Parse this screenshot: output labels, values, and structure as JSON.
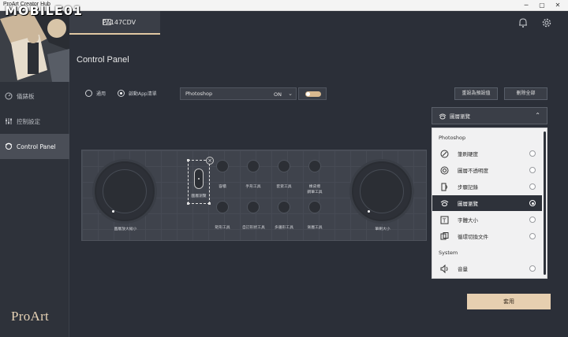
{
  "titlebar": {
    "title": "ProArt Creator Hub",
    "minimize": "─",
    "maximize": "▢",
    "close": "✕"
  },
  "watermark": "MOBILE01",
  "sidebar": {
    "items": [
      {
        "label": "儀錶板",
        "icon": "gauge-icon"
      },
      {
        "label": "控制設定",
        "icon": "sliders-icon"
      },
      {
        "label": "Control Panel",
        "icon": "dial-icon"
      }
    ],
    "logo": "ProArt"
  },
  "header": {
    "device_tab": "PA147CDV",
    "bell_icon": "bell-icon",
    "settings_icon": "gear-icon"
  },
  "main": {
    "title": "Control Panel",
    "radio_off_label": "通用",
    "radio_on_label": "啟動App清單",
    "app_select": {
      "value": "Photoshop",
      "state": "ON"
    },
    "reset_button": "重設為預設值",
    "delete_all_button": "刪除全部"
  },
  "device": {
    "left_dial_label": "圖層放大縮小",
    "right_dial_label": "筆刷大小",
    "selected_control_label": "圖層瀏覽",
    "top_labels": [
      "容積",
      "手形工具",
      "套索工具",
      "橡皮擦",
      "鋼筆工具"
    ],
    "bottom_labels": [
      "矩形工具",
      "自訂形狀工具",
      "多邊形工具",
      "漸層工具"
    ]
  },
  "function_menu": {
    "selected": "圖層瀏覽",
    "sections": [
      {
        "name": "Photoshop",
        "items": [
          {
            "label": "筆刷硬度",
            "icon": "brush-hardness-icon"
          },
          {
            "label": "圖層不透明度",
            "icon": "opacity-icon"
          },
          {
            "label": "步驟記錄",
            "icon": "history-icon"
          },
          {
            "label": "圖層瀏覽",
            "icon": "layer-browse-icon",
            "selected": true
          },
          {
            "label": "字體大小",
            "icon": "font-size-icon"
          },
          {
            "label": "循環切換文件",
            "icon": "cycle-document-icon"
          }
        ]
      },
      {
        "name": "System",
        "items": [
          {
            "label": "音量",
            "icon": "volume-icon"
          }
        ]
      }
    ]
  },
  "apply_button": "套用",
  "colors": {
    "accent": "#e6cfb0",
    "background": "#2b2f38",
    "panel": "#3f434c"
  }
}
